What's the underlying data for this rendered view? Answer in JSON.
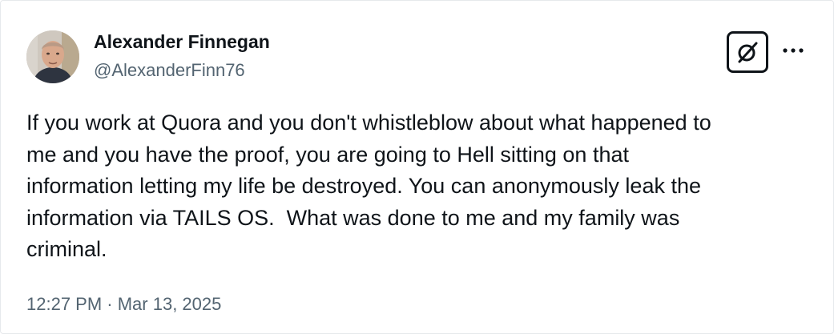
{
  "author": {
    "display_name": "Alexander Finnegan",
    "handle": "@AlexanderFinn76"
  },
  "icons": {
    "avatar": "avatar",
    "grok": "grok-icon",
    "more": "more-horizontal-icon"
  },
  "tweet": {
    "text": "If you work at Quora and you don't whistleblow about what happened to\nme and you have the proof, you are going to Hell sitting on that\ninformation letting my life be destroyed. You can anonymously leak the\ninformation via TAILS OS.  What was done to me and my family was\ncriminal.",
    "timestamp": "12:27 PM · Mar 13, 2025"
  },
  "colors": {
    "text_primary": "#0f1419",
    "text_secondary": "#536471",
    "border": "#e6e9ec",
    "background": "#ffffff"
  }
}
